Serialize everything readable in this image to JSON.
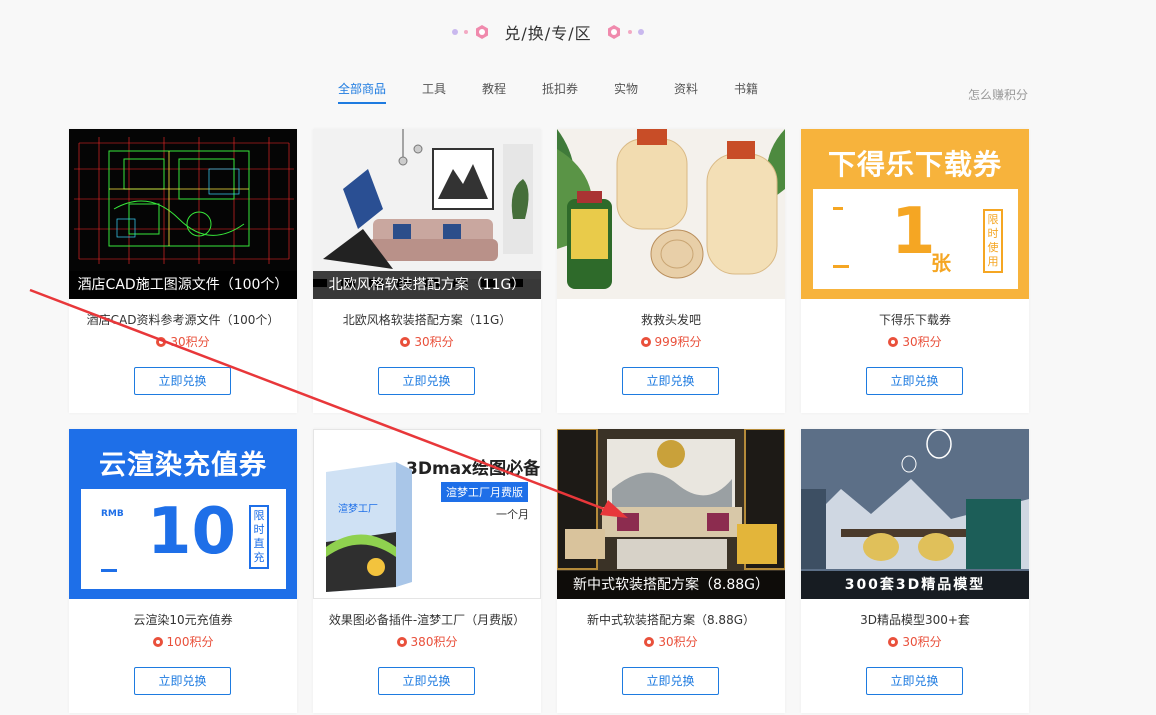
{
  "header": {
    "title": "兑/换/专/区"
  },
  "tabs": [
    "全部商品",
    "工具",
    "教程",
    "抵扣券",
    "实物",
    "资料",
    "书籍"
  ],
  "earn_link": "怎么赚积分",
  "button_label": "立即兑换",
  "colors": {
    "accent": "#1e7be0",
    "points": "#e9503b",
    "arrow": "#e8373a"
  },
  "products": [
    {
      "caption": "酒店CAD施工图源文件（100个）",
      "name": "酒店CAD资料参考源文件（100个）",
      "points": "30积分"
    },
    {
      "caption": "北欧风格软装搭配方案（11G）",
      "name": "北欧风格软装搭配方案（11G）",
      "points": "30积分"
    },
    {
      "caption": "",
      "name": "救救头发吧",
      "points": "999积分"
    },
    {
      "caption": "",
      "name": "下得乐下载券",
      "points": "30积分",
      "image_title": "下得乐下载券",
      "image_value": "1",
      "image_unit": "张",
      "image_badge": "限时使用"
    },
    {
      "caption": "",
      "name": "云渲染10元充值券",
      "points": "100积分",
      "image_title": "云渲染充值券",
      "image_value": "10",
      "image_unit": "RMB",
      "image_badge": "限时直充"
    },
    {
      "caption": "",
      "name": "效果图必备插件-渲梦工厂（月费版）",
      "points": "380积分",
      "image_title": "3Dmax绘图必备",
      "image_tag": "渲梦工厂月费版",
      "image_sub": "一个月",
      "image_box_label": "渲梦工厂"
    },
    {
      "caption": "新中式软装搭配方案（8.88G）",
      "name": "新中式软装搭配方案（8.88G）",
      "points": "30积分"
    },
    {
      "caption": "300套3D精品模型",
      "name": "3D精品模型300+套",
      "points": "30积分"
    }
  ]
}
